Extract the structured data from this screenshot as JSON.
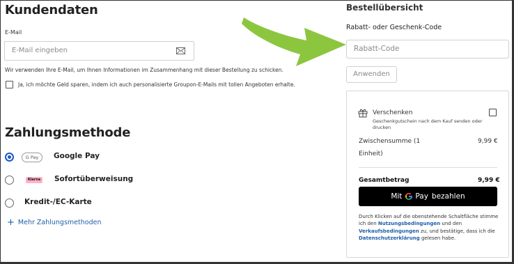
{
  "customer": {
    "title": "Kundendaten",
    "email_label": "E-Mail",
    "email_placeholder": "E-Mail eingeben",
    "email_note": "Wir verwenden Ihre E-Mail, um Ihnen Informationen im Zusammenhang mit dieser Bestellung zu schicken.",
    "newsletter_label": "Ja, ich möchte Geld sparen, indem ich auch personalisierte Groupon-E-Mails mit tollen Angeboten erhalte."
  },
  "payment": {
    "title": "Zahlungsmethode",
    "methods": [
      {
        "name": "Google Pay",
        "badge": "G Pay",
        "icon": "google-pay-icon",
        "selected": true
      },
      {
        "name": "Sofortüberweisung",
        "badge": "Klarna",
        "icon": "klarna-icon",
        "selected": false
      },
      {
        "name": "Kredit-/EC-Karte",
        "badge": "",
        "icon": "",
        "selected": false
      }
    ],
    "more_label": "Mehr Zahlungsmethoden"
  },
  "order": {
    "title": "Bestellübersicht",
    "coupon_label": "Rabatt- oder Geschenk-Code",
    "coupon_placeholder": "Rabatt-Code",
    "apply_label": "Anwenden",
    "gift_label": "Verschenken",
    "gift_note_line1": "Geschenkgutschein nach dem Kauf senden oder",
    "gift_note_line2": "drucken",
    "subtotal_label_line1": "Zwischensumme (1",
    "subtotal_label_line2": "Einheit)",
    "subtotal_value": "9,99 €",
    "total_label": "Gesamtbetrag",
    "total_value": "9,99 €",
    "pay_button_prefix": "Mit",
    "pay_button_brand": "Pay",
    "pay_button_suffix": "bezahlen",
    "legal": {
      "t1": "Durch Klicken auf die obenstehende Schaltfläche stimme ich den ",
      "link1": "Nutzungsbedingungen",
      "t2": " und den ",
      "link2": "Verkaufsbedingungen",
      "t3": " zu, und bestätige, dass ich die ",
      "link3": "Datenschutzerklärung",
      "t4": " gelesen habe."
    }
  },
  "colors": {
    "accent": "#1a57c8",
    "link": "#1f5fa8",
    "arrow": "#8cc63f",
    "pay_button": "#000000"
  }
}
